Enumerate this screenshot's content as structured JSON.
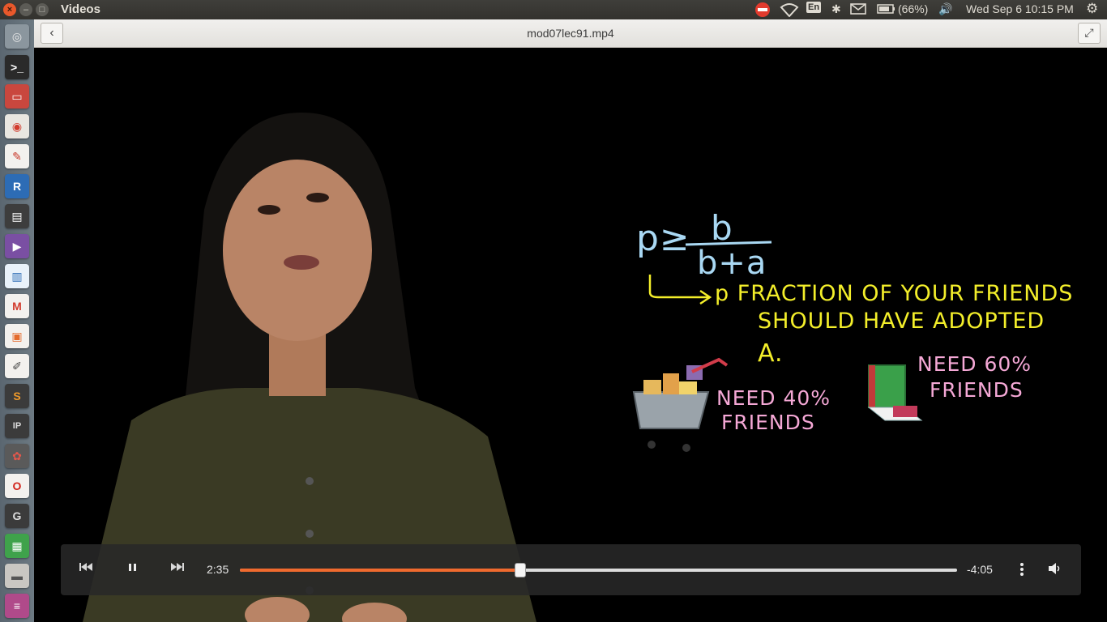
{
  "panel": {
    "app_title": "Videos",
    "keyboard": "En",
    "battery": "(66%)",
    "clock": "Wed Sep  6 10:15 PM"
  },
  "header": {
    "title": "mod07lec91.mp4",
    "back_icon": "chevron-left-icon",
    "fullscreen_icon": "fullscreen-icon"
  },
  "launcher": {
    "items": [
      "dash",
      "terminal",
      "files",
      "chrome",
      "pdf-viewer",
      "r",
      "video-editor",
      "videos",
      "document",
      "gmail",
      "presentation",
      "text-editor",
      "sublime",
      "ipython",
      "settings",
      "opera",
      "gp",
      "spreadsheet",
      "drive",
      "recording"
    ]
  },
  "video": {
    "formula_lhs": "p≥",
    "formula_num": "b",
    "formula_den": "b+a",
    "note_line1": "p FRACTION OF YOUR FRIENDS",
    "note_line2": "SHOULD HAVE ADOPTED",
    "note_line3": "A.",
    "label_left_1": "NEED 40%",
    "label_left_2": "FRIENDS",
    "label_right_1": "NEED 60%",
    "label_right_2": "FRIENDS"
  },
  "player": {
    "elapsed": "2:35",
    "remaining": "-4:05",
    "progress": 0.39,
    "accent": "#f06a2e"
  }
}
